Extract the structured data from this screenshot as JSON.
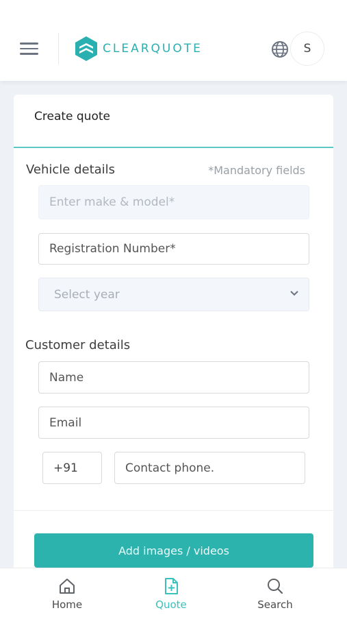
{
  "header": {
    "brand": "CLEARQUOTE",
    "avatar_initial": "S",
    "brand_color": "#2ab0b0"
  },
  "form": {
    "title": "Create quote",
    "vehicle_section": "Vehicle details",
    "mandatory_note": "*Mandatory fields",
    "make_model_placeholder": "Enter make & model*",
    "registration_placeholder": "Registration Number*",
    "year_placeholder": "Select year",
    "customer_section": "Customer details",
    "name_placeholder": "Name",
    "email_placeholder": "Email",
    "country_code": "+91",
    "phone_placeholder": "Contact phone.",
    "add_media_label": "Add images / videos"
  },
  "bottom_nav": {
    "items": [
      {
        "label": "Home",
        "icon": "home-icon"
      },
      {
        "label": "Quote",
        "icon": "quote-file-icon"
      },
      {
        "label": "Search",
        "icon": "search-icon"
      }
    ],
    "active": "Quote",
    "active_color": "#3cc0bb"
  }
}
